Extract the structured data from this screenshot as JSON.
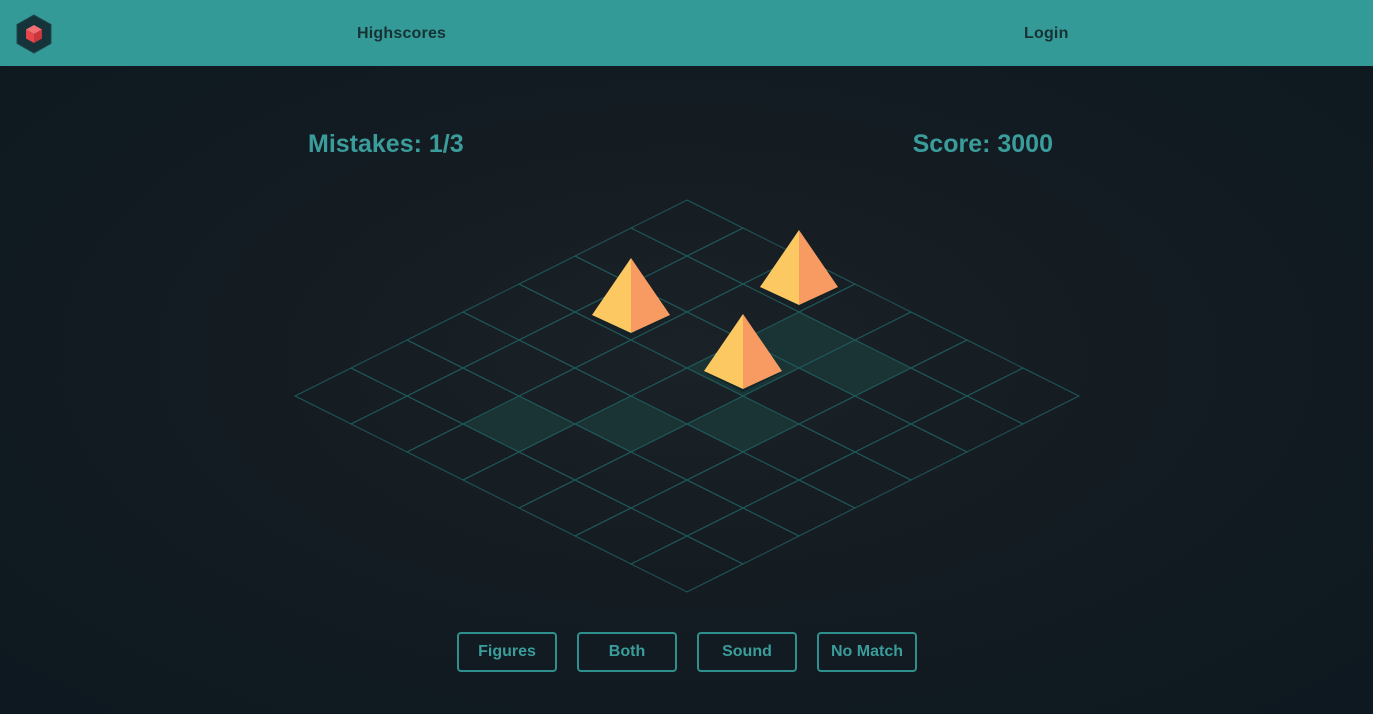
{
  "nav": {
    "highscores_label": "Highscores",
    "login_label": "Login"
  },
  "stats": {
    "mistakes_label": "Mistakes: 1/3",
    "score_label": "Score: 3000"
  },
  "board": {
    "rows": 7,
    "cols": 7,
    "highlighted_cells": [
      [
        1,
        3
      ],
      [
        1,
        4
      ],
      [
        2,
        3
      ],
      [
        3,
        4
      ],
      [
        4,
        3
      ],
      [
        5,
        2
      ]
    ],
    "pyramids": [
      [
        0,
        2
      ],
      [
        2,
        3
      ],
      [
        2,
        1
      ]
    ]
  },
  "buttons": {
    "figures_label": "Figures",
    "both_label": "Both",
    "sound_label": "Sound",
    "nomatch_label": "No Match"
  },
  "colors": {
    "header": "#349a98",
    "accent": "#3a9d9b",
    "grid_line": "#1f5a5a",
    "cell_highlight": "#1a3436",
    "pyramid_left": "#fbc862",
    "pyramid_right": "#f79b62",
    "logo_cube": "#e8464a"
  },
  "icons": {
    "logo": "cube-logo-icon"
  }
}
